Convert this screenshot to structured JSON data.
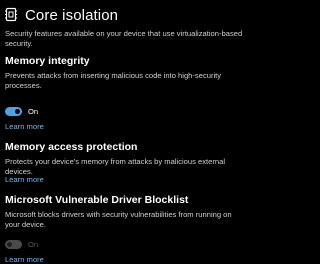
{
  "page": {
    "title": "Core isolation",
    "description": "Security features available on your device that use virtualization-based security.",
    "title_icon": "shield-chip-icon"
  },
  "memory_integrity": {
    "title": "Memory integrity",
    "description": "Prevents attacks from inserting malicious code into high-security processes.",
    "toggle_state": "on",
    "toggle_label": "On",
    "learn_more": "Learn more"
  },
  "memory_access_protection": {
    "title": "Memory access protection",
    "description": "Protects your device's memory from attacks by malicious external devices.",
    "learn_more": "Learn more"
  },
  "driver_blocklist": {
    "title": "Microsoft Vulnerable Driver Blocklist",
    "description": "Microsoft blocks drivers with security vulnerabilities from running on your device.",
    "toggle_state": "on-disabled",
    "toggle_label": "On",
    "learn_more": "Learn more"
  },
  "colors": {
    "background": "#000000",
    "accent": "#4aa3e6",
    "link": "#6fb6ef",
    "disabled": "#5a5a5a"
  }
}
